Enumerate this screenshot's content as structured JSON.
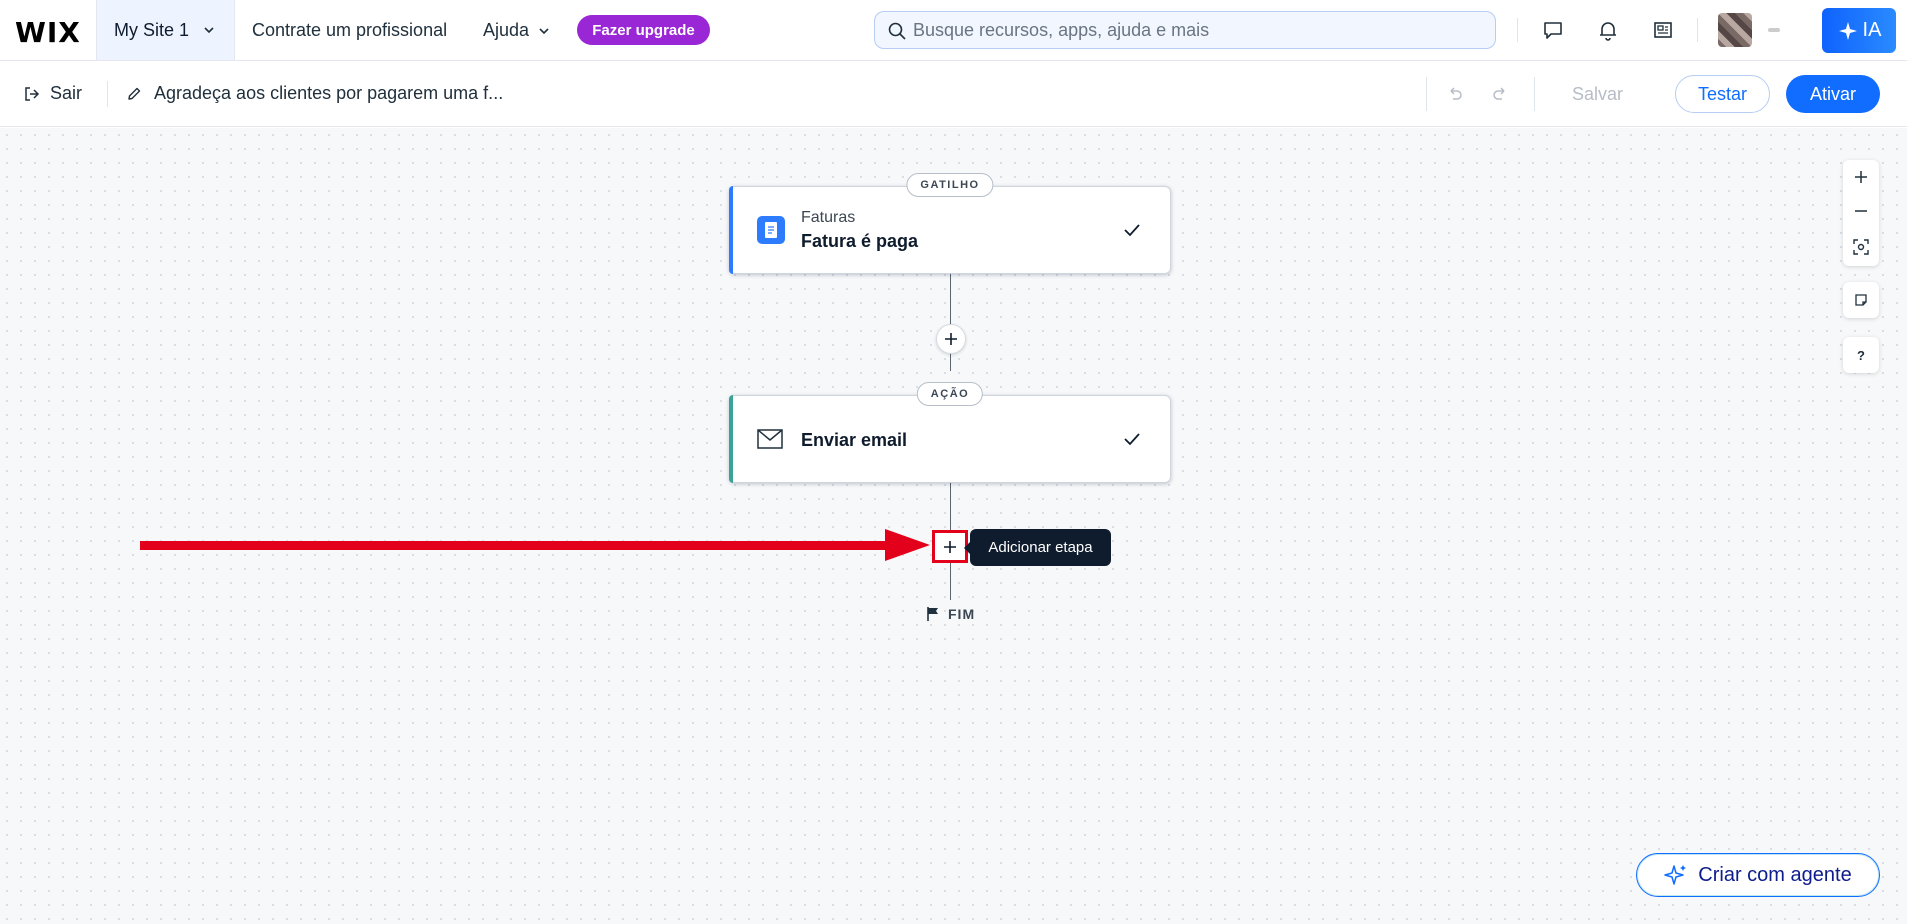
{
  "topbar": {
    "logo": "WIX",
    "site_name": "My Site 1",
    "hire_link": "Contrate um profissional",
    "help_link": "Ajuda",
    "upgrade_label": "Fazer upgrade",
    "search_placeholder": "Busque recursos, apps, ajuda e mais",
    "ai_label": "IA"
  },
  "subbar": {
    "exit_label": "Sair",
    "flow_name": "Agradeça aos clientes por pagarem uma f...",
    "save_label": "Salvar",
    "test_label": "Testar",
    "activate_label": "Ativar"
  },
  "flow": {
    "trigger": {
      "tag": "GATILHO",
      "app": "Faturas",
      "title": "Fatura é paga",
      "accent": "#2d7bff"
    },
    "action": {
      "tag": "AÇÃO",
      "title": "Enviar email",
      "accent": "#3aa397"
    },
    "tooltip": "Adicionar etapa",
    "end_label": "FIM"
  },
  "side_controls": {
    "help_label": "?"
  },
  "agent_button": "Criar com agente",
  "colors": {
    "primary": "#116dff",
    "upgrade": "#9a27d5",
    "annotation": "#e3001b"
  }
}
